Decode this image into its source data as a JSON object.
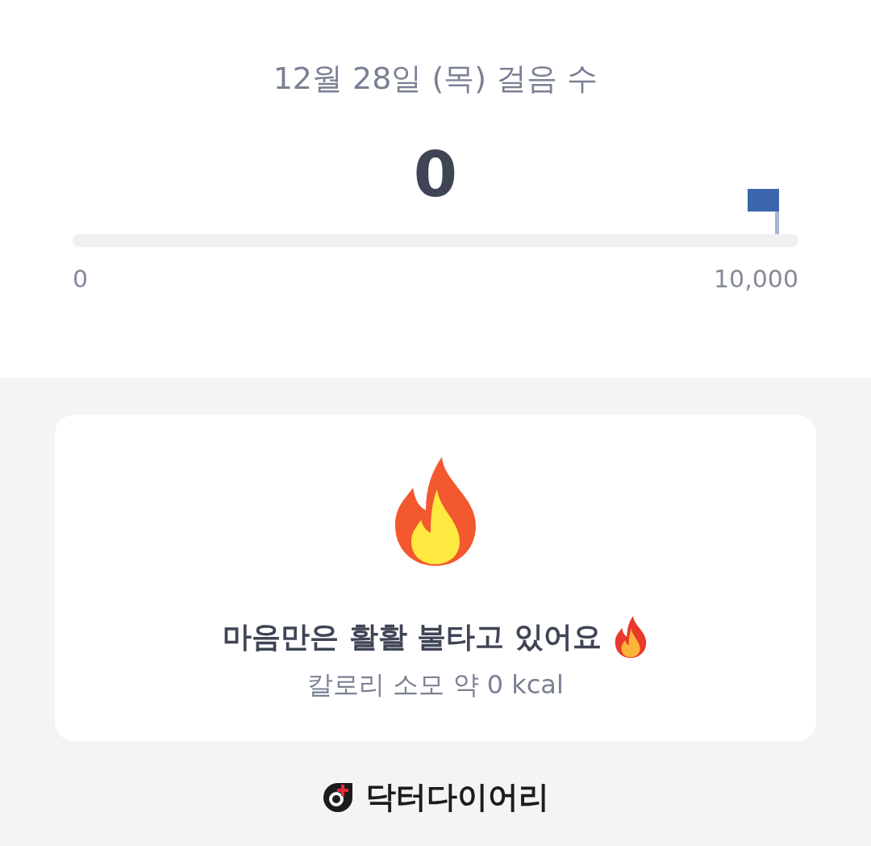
{
  "header": {
    "title": "12월 28일 (목) 걸음 수",
    "steps": "0"
  },
  "progress": {
    "level": 0,
    "min_label": "0",
    "max_label": "10,000"
  },
  "card": {
    "headline": "마음만은 활활 불타고 있어요",
    "calories": "칼로리 소모 약 0 kcal"
  },
  "footer": {
    "brand": "닥터다이어리"
  }
}
